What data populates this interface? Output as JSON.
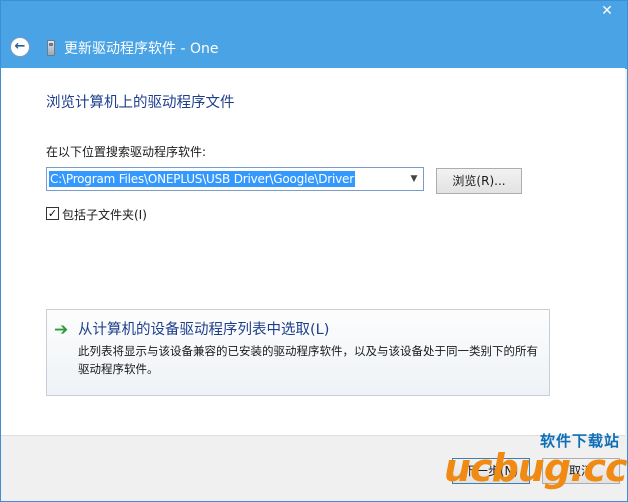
{
  "window": {
    "title": "更新驱动程序软件 - One",
    "close_glyph": "✕"
  },
  "icons": {
    "back": "back-arrow-icon",
    "device": "usb-device-icon",
    "pick": "green-arrow-icon"
  },
  "content": {
    "heading": "浏览计算机上的驱动程序文件",
    "path_label": "在以下位置搜索驱动程序软件:",
    "path_value": "C:\\Program Files\\ONEPLUS\\USB Driver\\Google\\Driver",
    "browse_label": "浏览(R)...",
    "include_subfolders_label": "包括子文件夹(I)",
    "include_subfolders_checked": true,
    "pick_title": "从计算机的设备驱动程序列表中选取(L)",
    "pick_desc": "此列表将显示与该设备兼容的已安装的驱动程序软件，以及与该设备处于同一类别下的所有驱动程序软件。"
  },
  "footer": {
    "next_label": "下一步(N)",
    "cancel_label": "取消"
  },
  "watermark": {
    "top": "软件下载站",
    "main": "ucbug.cc"
  },
  "colors": {
    "titlebar": "#4aa3e4",
    "heading": "#1e3f8c",
    "selection": "#3399ff",
    "watermark_orange": "#f08a12",
    "watermark_blue": "#0e6fb8"
  }
}
